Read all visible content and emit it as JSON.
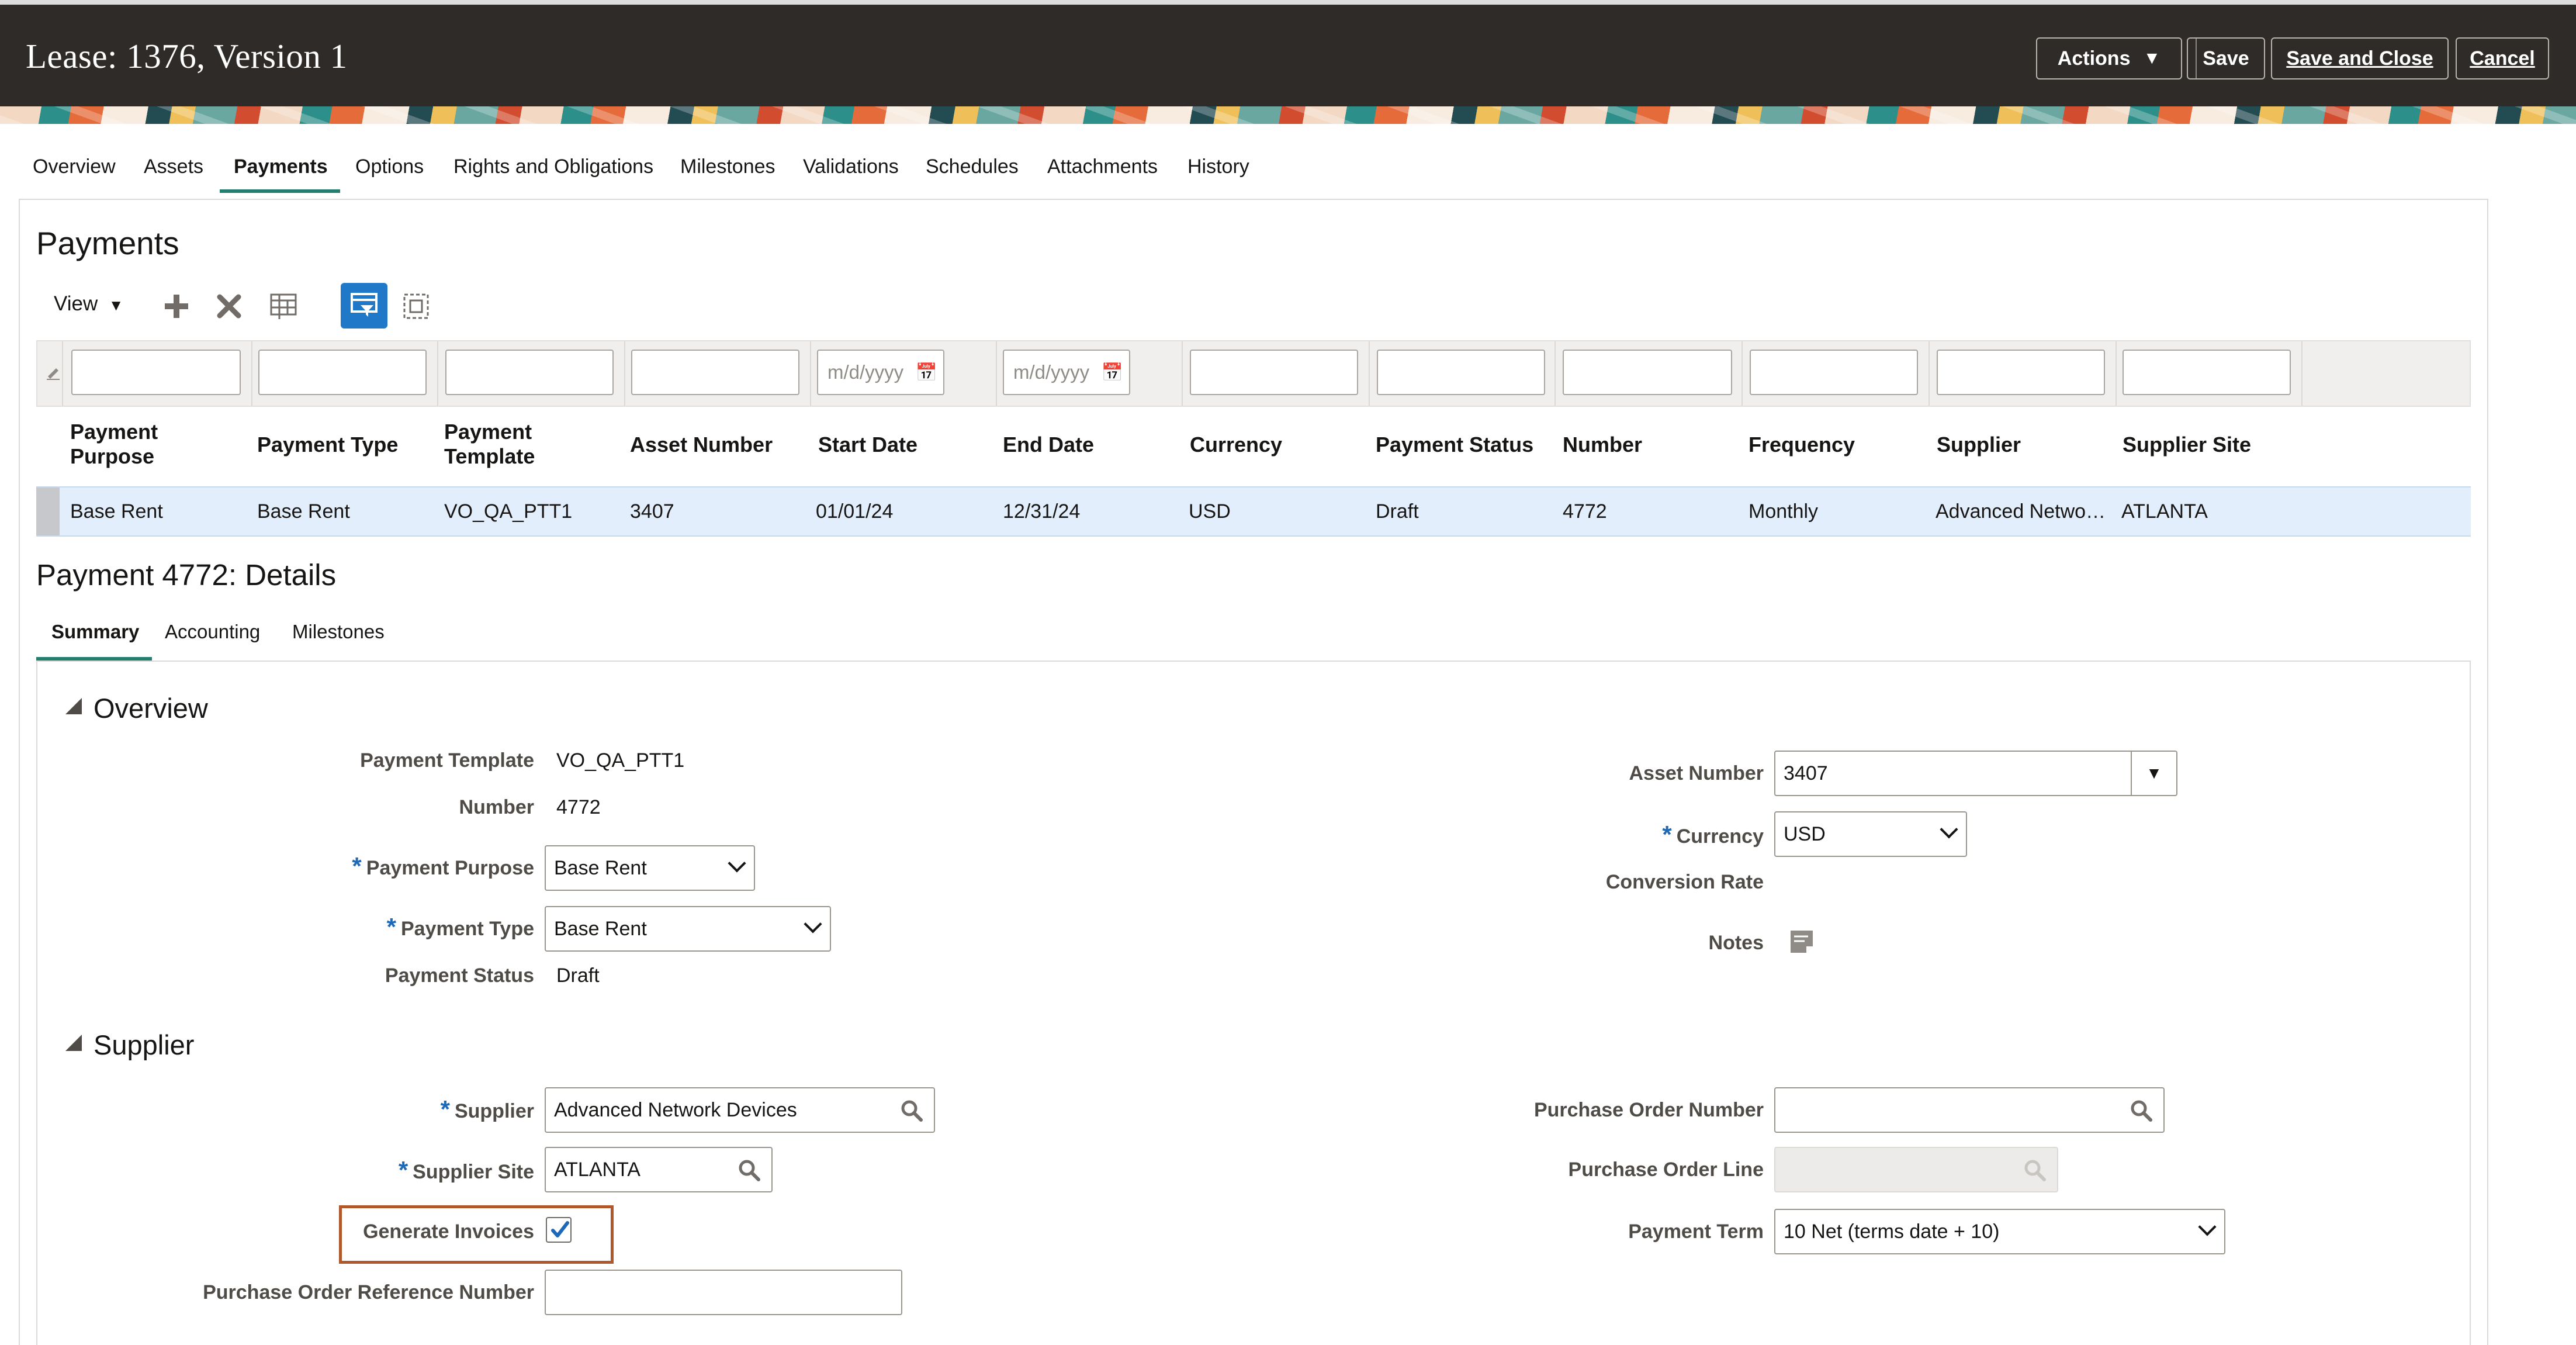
{
  "header": {
    "title": "Lease: 1376, Version 1",
    "actions_label": "Actions",
    "save_label": "Save",
    "save_close_label": "Save and Close",
    "cancel_label": "Cancel"
  },
  "tabs": [
    {
      "label": "Overview"
    },
    {
      "label": "Assets"
    },
    {
      "label": "Payments"
    },
    {
      "label": "Options"
    },
    {
      "label": "Rights and Obligations"
    },
    {
      "label": "Milestones"
    },
    {
      "label": "Validations"
    },
    {
      "label": "Schedules"
    },
    {
      "label": "Attachments"
    },
    {
      "label": "History"
    }
  ],
  "payments": {
    "title": "Payments",
    "toolbar": {
      "view_label": "View",
      "icons": [
        "add-icon",
        "delete-icon",
        "freeze-icon",
        "query-by-example-icon",
        "detach-icon"
      ]
    },
    "filter_placeholder": "m/d/yyyy",
    "columns": [
      {
        "line1": "Payment",
        "line2": "Purpose"
      },
      {
        "line1": "Payment Type",
        "line2": ""
      },
      {
        "line1": "Payment",
        "line2": "Template"
      },
      {
        "line1": "Asset Number",
        "line2": ""
      },
      {
        "line1": "Start Date",
        "line2": ""
      },
      {
        "line1": "End Date",
        "line2": ""
      },
      {
        "line1": "Currency",
        "line2": ""
      },
      {
        "line1": "Payment Status",
        "line2": ""
      },
      {
        "line1": "Number",
        "line2": ""
      },
      {
        "line1": "Frequency",
        "line2": ""
      },
      {
        "line1": "Supplier",
        "line2": ""
      },
      {
        "line1": "Supplier Site",
        "line2": ""
      }
    ],
    "rows": [
      [
        "Base Rent",
        "Base Rent",
        "VO_QA_PTT1",
        "3407",
        "01/01/24",
        "12/31/24",
        "USD",
        "Draft",
        "4772",
        "Monthly",
        "Advanced Netwo…",
        "ATLANTA"
      ]
    ]
  },
  "details": {
    "title": "Payment 4772: Details",
    "subtabs": [
      {
        "label": "Summary"
      },
      {
        "label": "Accounting"
      },
      {
        "label": "Milestones"
      }
    ],
    "overview": {
      "title": "Overview",
      "payment_template_label": "Payment Template",
      "payment_template_value": "VO_QA_PTT1",
      "number_label": "Number",
      "number_value": "4772",
      "payment_purpose_label": "Payment Purpose",
      "payment_purpose_value": "Base Rent",
      "payment_type_label": "Payment Type",
      "payment_type_value": "Base Rent",
      "payment_status_label": "Payment Status",
      "payment_status_value": "Draft",
      "asset_number_label": "Asset Number",
      "asset_number_value": "3407",
      "currency_label": "Currency",
      "currency_value": "USD",
      "conversion_rate_label": "Conversion Rate",
      "notes_label": "Notes",
      "required_marker": "*"
    },
    "supplier": {
      "title": "Supplier",
      "supplier_label": "Supplier",
      "supplier_value": "Advanced Network Devices",
      "supplier_site_label": "Supplier Site",
      "supplier_site_value": "ATLANTA",
      "generate_invoices_label": "Generate Invoices",
      "generate_invoices_checked": true,
      "po_ref_label": "Purchase Order Reference Number",
      "po_ref_value": "",
      "po_number_label": "Purchase Order Number",
      "po_number_value": "",
      "po_line_label": "Purchase Order Line",
      "po_line_value": "",
      "payment_term_label": "Payment Term",
      "payment_term_value": "10 Net (terms date + 10)"
    }
  },
  "colors": {
    "header_bg": "#2e2b28",
    "tab_accent": "#227e6e",
    "selected_row": "#e2eefb",
    "required": "#1e68b8",
    "highlight_box": "#b0572c",
    "checkmark": "#1e68b8"
  }
}
